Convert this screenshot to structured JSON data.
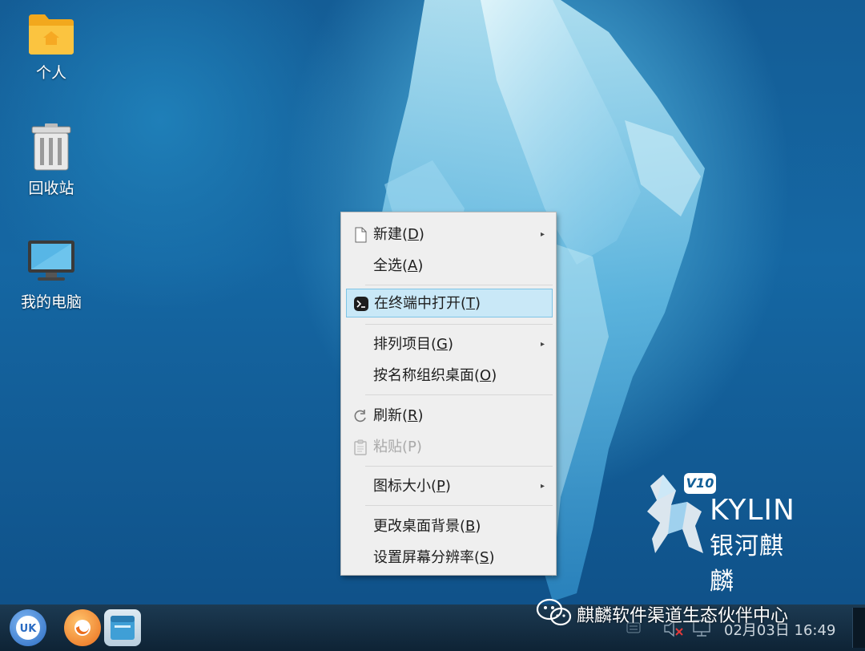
{
  "desktop": {
    "icons": [
      {
        "label": "个人",
        "icon": "home-folder-icon"
      },
      {
        "label": "回收站",
        "icon": "trash-icon"
      },
      {
        "label": "我的电脑",
        "icon": "computer-icon"
      }
    ],
    "logo": {
      "badge": "V10",
      "word": "KYLIN",
      "cn": "银河麒麟"
    }
  },
  "context_menu": {
    "items": [
      {
        "label": "新建(",
        "key": "D",
        "icon": "new-document-icon",
        "submenu": true,
        "state": "normal"
      },
      {
        "label": "全选(",
        "key": "A",
        "icon": "",
        "submenu": false,
        "state": "normal"
      },
      {
        "label": "在终端中打开(",
        "key": "T",
        "icon": "terminal-icon",
        "submenu": false,
        "state": "highlighted"
      },
      {
        "label": "排列项目(",
        "key": "G",
        "icon": "",
        "submenu": true,
        "state": "normal"
      },
      {
        "label": "按名称组织桌面(",
        "key": "O",
        "icon": "",
        "submenu": false,
        "state": "normal"
      },
      {
        "label": "刷新(",
        "key": "R",
        "icon": "refresh-icon",
        "submenu": false,
        "state": "normal"
      },
      {
        "label": "粘贴(P)",
        "key": "",
        "icon": "paste-icon",
        "submenu": false,
        "state": "disabled"
      },
      {
        "label": "图标大小(",
        "key": "P",
        "icon": "",
        "submenu": true,
        "state": "normal"
      },
      {
        "label": "更改桌面背景(",
        "key": "B",
        "icon": "",
        "submenu": false,
        "state": "normal"
      },
      {
        "label": "设置屏幕分辨率(",
        "key": "S",
        "icon": "",
        "submenu": false,
        "state": "normal"
      }
    ],
    "close_paren": ")",
    "submenu_arrow": "▸"
  },
  "taskbar": {
    "clock": "02月03日 16:49",
    "launchers": [
      "start-menu-icon",
      "browser-icon",
      "file-manager-icon"
    ]
  },
  "watermark": {
    "text": "麒麟软件渠道生态伙伴中心"
  },
  "colors": {
    "highlight_bg": "#c9e8f7",
    "highlight_border": "#7ec4e6",
    "menu_bg": "#efefef",
    "taskbar": "#13293c"
  }
}
